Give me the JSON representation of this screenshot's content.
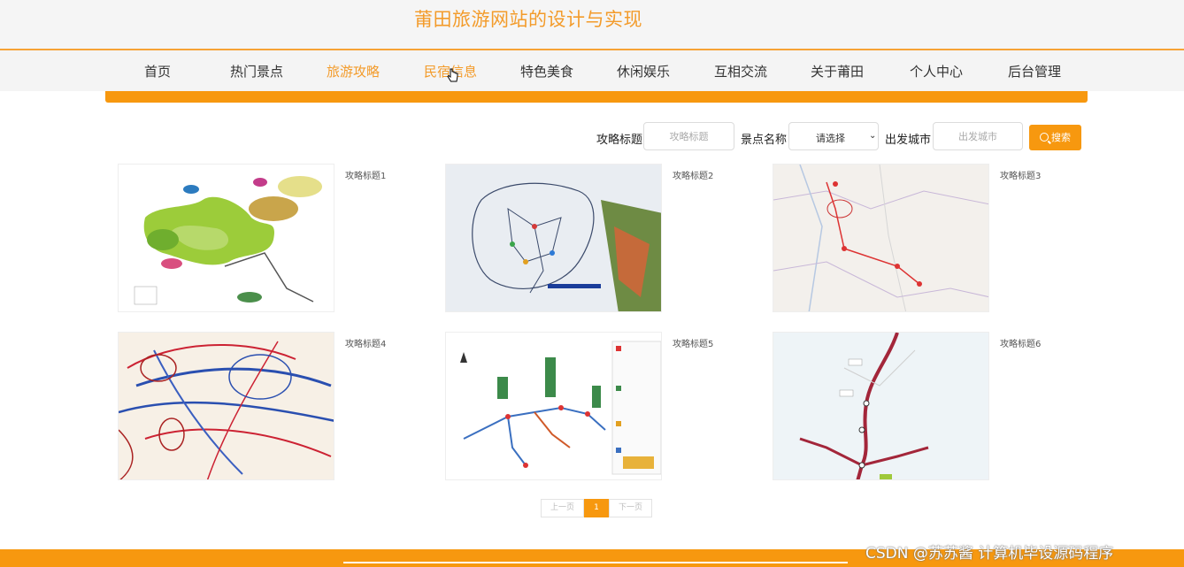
{
  "header": {
    "title": "莆田旅游网站的设计与实现"
  },
  "nav": {
    "items": [
      "首页",
      "热门景点",
      "旅游攻略",
      "民宿信息",
      "特色美食",
      "休闲娱乐",
      "互相交流",
      "关于莆田",
      "个人中心",
      "后台管理"
    ],
    "active_index": 2
  },
  "search": {
    "title_label": "攻略标题",
    "title_placeholder": "攻略标题",
    "spot_label": "景点名称",
    "spot_selected": "请选择",
    "city_label": "出发城市",
    "city_placeholder": "出发城市",
    "button_label": "搜索"
  },
  "cards": [
    {
      "title": "攻略标题1",
      "image": "stylized-green-region-map"
    },
    {
      "title": "攻略标题2",
      "image": "photo-of-route-map-board"
    },
    {
      "title": "攻略标题3",
      "image": "province-road-map"
    },
    {
      "title": "攻略标题4",
      "image": "flight-route-map"
    },
    {
      "title": "攻略标题5",
      "image": "scenic-area-transit-map"
    },
    {
      "title": "攻略标题6",
      "image": "highway-road-map"
    }
  ],
  "pagination": {
    "prev": "上一页",
    "current": "1",
    "next": "下一页"
  },
  "watermark": "CSDN @苏苏酱  计算机毕设源码程序",
  "colors": {
    "accent": "#f7980f",
    "title": "#f39b2a"
  }
}
